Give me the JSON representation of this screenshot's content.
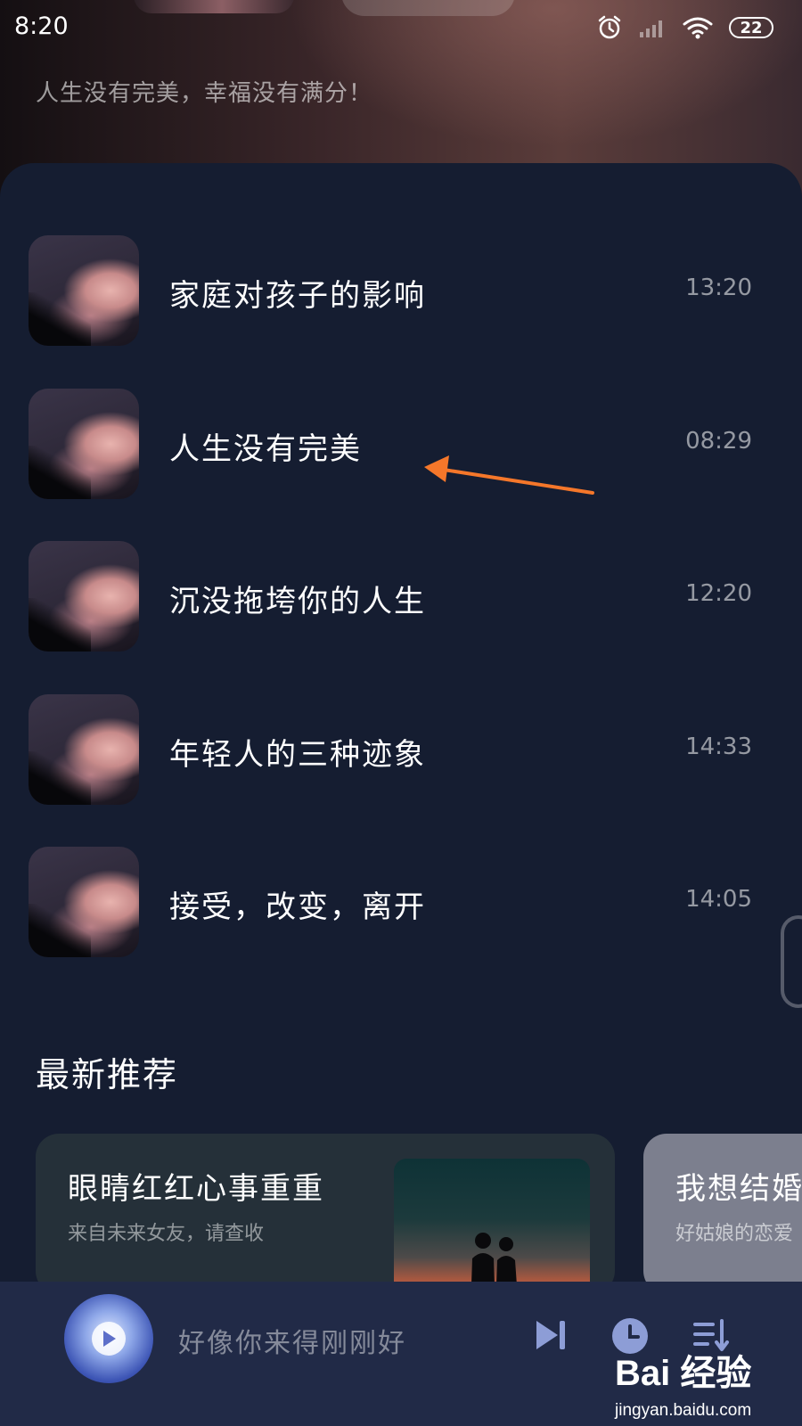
{
  "status_bar": {
    "time": "8:20",
    "battery": "22"
  },
  "header": {
    "subtitle": "人生没有完美，幸福没有满分！"
  },
  "songs": [
    {
      "title": "家庭对孩子的影响",
      "duration": "13:20"
    },
    {
      "title": "人生没有完美",
      "duration": "08:29"
    },
    {
      "title": "沉没拖垮你的人生",
      "duration": "12:20"
    },
    {
      "title": "年轻人的三种迹象",
      "duration": "14:33"
    },
    {
      "title": "接受，改变，离开",
      "duration": "14:05"
    }
  ],
  "recommend": {
    "section_title": "最新推荐",
    "cards": [
      {
        "title": "眼睛红红心事重重",
        "subtitle": "来自未来女友，请查收"
      },
      {
        "title": "我想结婚",
        "subtitle": "好姑娘的恋爱"
      }
    ]
  },
  "player": {
    "now_playing": "好像你来得刚刚好"
  },
  "watermark": {
    "brand": "Bai 经验",
    "url": "jingyan.baidu.com"
  },
  "colors": {
    "annotation_arrow": "#f5772a",
    "panel_bg": "#151d31",
    "player_bg": "#212a47"
  }
}
